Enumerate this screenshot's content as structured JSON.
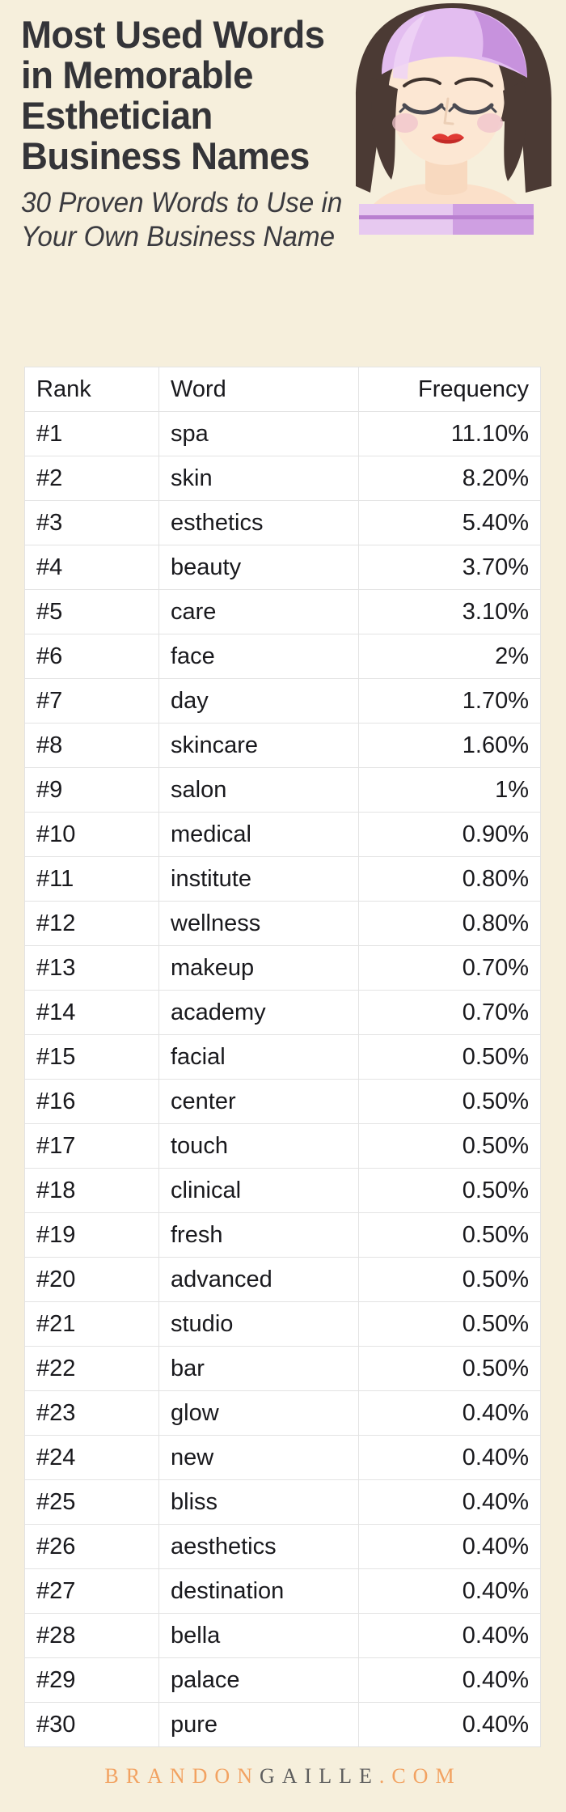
{
  "header": {
    "title_lines": [
      "Most Used Words",
      "in Memorable",
      "Esthetician",
      "Business Names"
    ],
    "subtitle_lines": [
      "30 Proven Words to Use in",
      "Your Own Business Name"
    ],
    "illustration_name": "esthetician-spa-woman-illustration"
  },
  "colors": {
    "background": "#f6efdc",
    "title_text": "#343438",
    "table_bg": "#ffffff",
    "table_border": "#e3e3e3",
    "brand_orange": "#f2a261",
    "brand_gray": "#5e5e5e",
    "headband": "#d9b3e8",
    "hair": "#4b3a34",
    "skin": "#fbe3cd",
    "lips": "#e03030",
    "towel": "#e2c2ec"
  },
  "footer": {
    "brand_part1": "BRANDON",
    "brand_part2": "GAILLE",
    "brand_part3": ".COM"
  },
  "chart_data": {
    "type": "table",
    "title": "Most Used Words in Memorable Esthetician Business Names",
    "subtitle": "30 Proven Words to Use in Your Own Business Name",
    "columns": [
      "Rank",
      "Word",
      "Frequency"
    ],
    "xlabel": "Word",
    "ylabel": "Frequency",
    "rows": [
      {
        "rank": "#1",
        "word": "spa",
        "frequency": "11.10%",
        "value": 11.1
      },
      {
        "rank": "#2",
        "word": "skin",
        "frequency": "8.20%",
        "value": 8.2
      },
      {
        "rank": "#3",
        "word": "esthetics",
        "frequency": "5.40%",
        "value": 5.4
      },
      {
        "rank": "#4",
        "word": "beauty",
        "frequency": "3.70%",
        "value": 3.7
      },
      {
        "rank": "#5",
        "word": "care",
        "frequency": "3.10%",
        "value": 3.1
      },
      {
        "rank": "#6",
        "word": "face",
        "frequency": "2%",
        "value": 2.0
      },
      {
        "rank": "#7",
        "word": "day",
        "frequency": "1.70%",
        "value": 1.7
      },
      {
        "rank": "#8",
        "word": "skincare",
        "frequency": "1.60%",
        "value": 1.6
      },
      {
        "rank": "#9",
        "word": "salon",
        "frequency": "1%",
        "value": 1.0
      },
      {
        "rank": "#10",
        "word": "medical",
        "frequency": "0.90%",
        "value": 0.9
      },
      {
        "rank": "#11",
        "word": "institute",
        "frequency": "0.80%",
        "value": 0.8
      },
      {
        "rank": "#12",
        "word": "wellness",
        "frequency": "0.80%",
        "value": 0.8
      },
      {
        "rank": "#13",
        "word": "makeup",
        "frequency": "0.70%",
        "value": 0.7
      },
      {
        "rank": "#14",
        "word": "academy",
        "frequency": "0.70%",
        "value": 0.7
      },
      {
        "rank": "#15",
        "word": "facial",
        "frequency": "0.50%",
        "value": 0.5
      },
      {
        "rank": "#16",
        "word": "center",
        "frequency": "0.50%",
        "value": 0.5
      },
      {
        "rank": "#17",
        "word": "touch",
        "frequency": "0.50%",
        "value": 0.5
      },
      {
        "rank": "#18",
        "word": "clinical",
        "frequency": "0.50%",
        "value": 0.5
      },
      {
        "rank": "#19",
        "word": "fresh",
        "frequency": "0.50%",
        "value": 0.5
      },
      {
        "rank": "#20",
        "word": "advanced",
        "frequency": "0.50%",
        "value": 0.5
      },
      {
        "rank": "#21",
        "word": "studio",
        "frequency": "0.50%",
        "value": 0.5
      },
      {
        "rank": "#22",
        "word": "bar",
        "frequency": "0.50%",
        "value": 0.5
      },
      {
        "rank": "#23",
        "word": "glow",
        "frequency": "0.40%",
        "value": 0.4
      },
      {
        "rank": "#24",
        "word": "new",
        "frequency": "0.40%",
        "value": 0.4
      },
      {
        "rank": "#25",
        "word": "bliss",
        "frequency": "0.40%",
        "value": 0.4
      },
      {
        "rank": "#26",
        "word": "aesthetics",
        "frequency": "0.40%",
        "value": 0.4
      },
      {
        "rank": "#27",
        "word": "destination",
        "frequency": "0.40%",
        "value": 0.4
      },
      {
        "rank": "#28",
        "word": "bella",
        "frequency": "0.40%",
        "value": 0.4
      },
      {
        "rank": "#29",
        "word": "palace",
        "frequency": "0.40%",
        "value": 0.4
      },
      {
        "rank": "#30",
        "word": "pure",
        "frequency": "0.40%",
        "value": 0.4
      }
    ]
  }
}
